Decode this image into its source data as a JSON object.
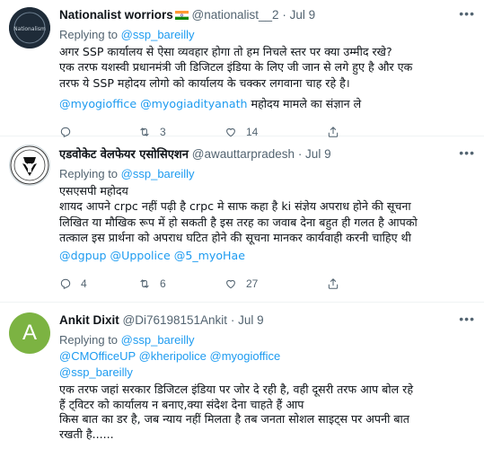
{
  "tweets": [
    {
      "name": "Nationalist worriors",
      "handle": "@nationalist__2",
      "date": "· Jul 9",
      "replying_prefix": "Replying to",
      "replying_to": "@ssp_bareilly",
      "lines": [
        "अगर SSP कार्यालय से ऐसा व्यवहार होगा तो हम निचले स्तर पर क्या उम्मीद रखे?",
        "एक तरफ यशस्वी प्रधानमंत्री जी डिजिटल इंडिया के लिए जी जान से लगे हुए है और एक",
        "तरफ ये SSP महोदय लोगो को कार्यालय के चक्कर लगवाना चाह रहे है।"
      ],
      "last_line_mentions": "@myogioffice @myogiadityanath",
      "last_line_text": " महोदय मामले का संज्ञान ले",
      "replies": "",
      "retweets": "3",
      "likes": "14",
      "avatar_text": "Nationalism"
    },
    {
      "name": "एडवोकेट वेलफेयर एसोसिएशन",
      "handle": "@awauttarpradesh",
      "date": "· Jul 9",
      "replying_prefix": "Replying to",
      "replying_to": "@ssp_bareilly",
      "lines": [
        "एसएसपी महोदय",
        "शायद आपने crpc नहीं पढ़ी है crpc मे साफ कहा है ki संज्ञेय अपराध होने की सूचना",
        "लिखित या मौखिक रूप में हो सकती है इस तरह का जवाब देना बहुत ही गलत है आपको",
        "तत्काल इस प्रार्थना को अपराध घटित होने की सूचना मानकर कार्यवाही करनी चाहिए थी"
      ],
      "mentions_line": "@dgpup @Uppolice @5_myoHae",
      "replies": "4",
      "retweets": "6",
      "likes": "27"
    },
    {
      "name": "Ankit Dixit",
      "handle": "@Di76198151Ankit",
      "date": "· Jul 9",
      "replying_prefix": "Replying to",
      "replying_to": "@ssp_bareilly",
      "mentions_line1": "@CMOfficeUP @kheripolice @myogioffice",
      "mentions_line2": "@ssp_bareilly",
      "lines": [
        "एक तरफ जहां सरकार डिजिटल इंडिया पर जोर दे रही है, वही दूसरी तरफ आप बोल रहे",
        "हैं ट्विटर को कार्यालय न बनाए,क्या संदेश देना चाहते हैं आप",
        "किस बात का डर है, जब न्याय नहीं मिलता है तब जनता सोशल साइट्स पर अपनी बात",
        "रखती है......"
      ],
      "avatar_letter": "A"
    }
  ],
  "colors": {
    "link": "#1d9bf0",
    "muted": "#536471",
    "text": "#0f1419",
    "avatar_green": "#7cb342"
  },
  "icons": [
    "reply-icon",
    "retweet-icon",
    "like-icon",
    "share-icon",
    "more-icon",
    "india-flag-icon"
  ]
}
